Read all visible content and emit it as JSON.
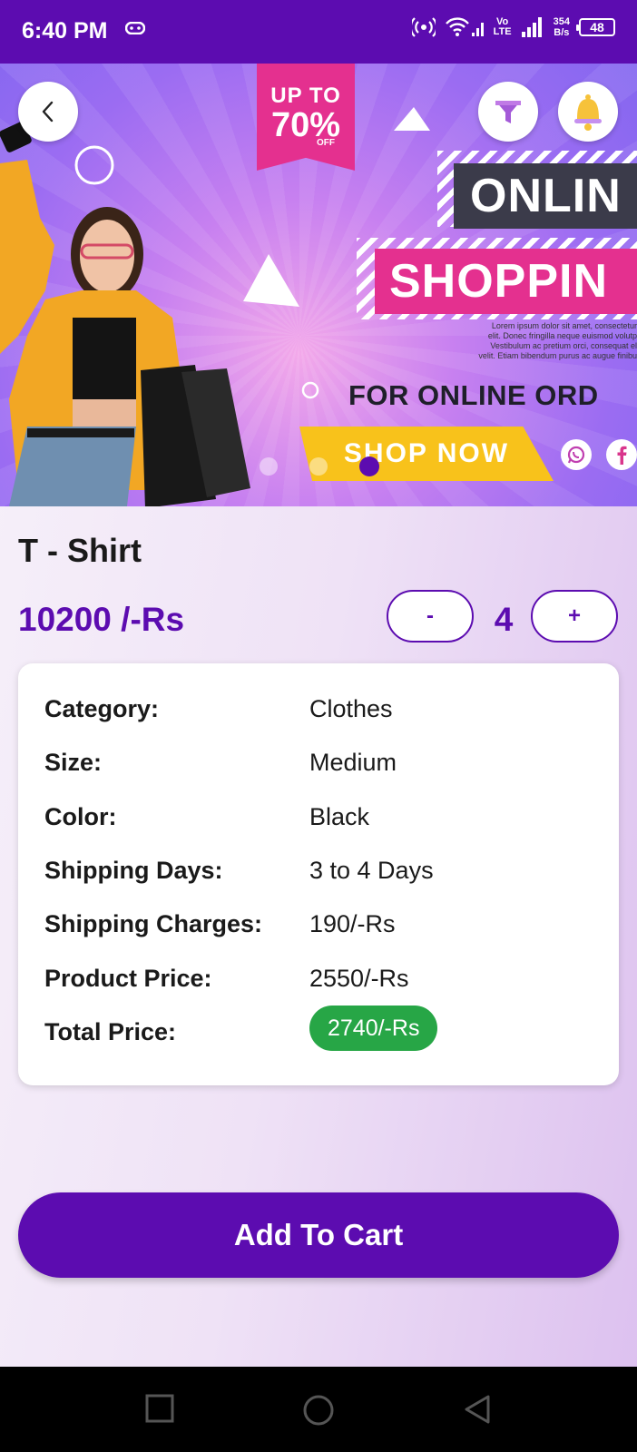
{
  "status_bar": {
    "time": "6:40 PM",
    "network_label_top": "Vo",
    "network_label_bottom": "LTE",
    "speed_value": "354",
    "speed_unit": "B/s",
    "battery": "48"
  },
  "banner": {
    "ribbon_line1": "UP TO",
    "ribbon_line2": "70%",
    "ribbon_off": "OFF",
    "headline1": "ONLIN",
    "headline2": "SHOPPIN",
    "lorem_lines": [
      "Lorem ipsum dolor sit amet, consectetur",
      "elit. Donec fringilla neque euismod volutp",
      "Vestibulum ac pretium orci, consequat el",
      "velit. Etiam bibendum purus ac augue finibu"
    ],
    "tagline": "FOR ONLINE ORD",
    "cta": "SHOP NOW",
    "carousel_active_index": 3,
    "carousel_count": 3
  },
  "product": {
    "title": "T - Shirt",
    "price": "10200 /-Rs",
    "quantity": "4",
    "minus_label": "-",
    "plus_label": "+"
  },
  "details": {
    "rows": [
      {
        "label": "Category:",
        "value": "Clothes"
      },
      {
        "label": "Size:",
        "value": "Medium"
      },
      {
        "label": "Color:",
        "value": "Black"
      },
      {
        "label": "Shipping Days:",
        "value": "3 to 4 Days"
      },
      {
        "label": "Shipping Charges:",
        "value": "190/-Rs"
      },
      {
        "label": "Product Price:",
        "value": "2550/-Rs"
      },
      {
        "label": "Total Price:",
        "value": "2740/-Rs"
      }
    ]
  },
  "actions": {
    "add_to_cart": "Add To Cart"
  },
  "colors": {
    "primary": "#5c0cb0",
    "total_badge": "#27a646",
    "banner_pink": "#e4308f",
    "banner_yellow": "#f8c21b"
  },
  "icons": {
    "back": "chevron-left-icon",
    "filter": "funnel-icon",
    "notification": "bell-icon",
    "nav_recent": "square-icon",
    "nav_home": "circle-icon",
    "nav_back": "triangle-left-icon"
  }
}
